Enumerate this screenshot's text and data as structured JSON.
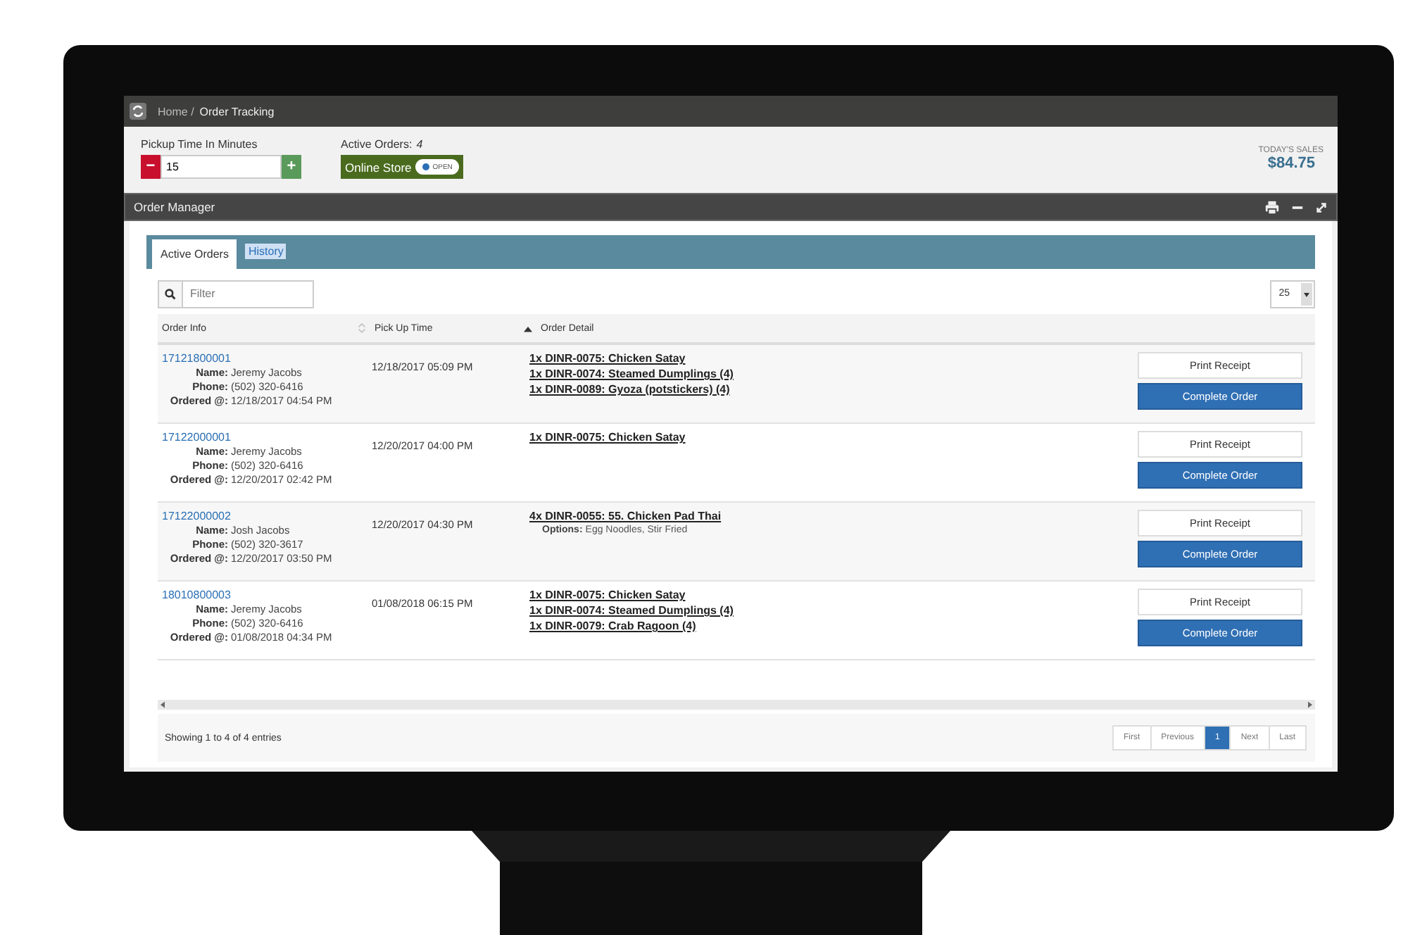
{
  "breadcrumb": [
    "Home /",
    "Order Tracking"
  ],
  "pickup": {
    "label": "Pickup Time In Minutes",
    "value": "15",
    "minus": "−",
    "plus": "+"
  },
  "active_orders": {
    "label": "Active Orders:",
    "count": "4"
  },
  "online_store": {
    "label": "Online Store",
    "on": true,
    "state_text": "OPEN"
  },
  "sales": {
    "label": "TODAY'S SALES",
    "amount": "$84.75"
  },
  "panel": {
    "title": "Order Manager"
  },
  "tabs": [
    {
      "label": "Active Orders",
      "selected": true
    },
    {
      "label": "History",
      "selected": false
    }
  ],
  "filter": {
    "placeholder": "Filter"
  },
  "page_size": "25",
  "columns": [
    {
      "label": "Order Info",
      "kind": "plain"
    },
    {
      "label": "Pick Up Time",
      "kind": "sortable"
    },
    {
      "label": "Order Detail",
      "kind": "ascending"
    }
  ],
  "rows": [
    {
      "order": "17121800001",
      "fields": [
        {
          "label": "Name:",
          "value": "Jeremy Jacobs"
        },
        {
          "label": "Phone:",
          "value": "(502) 320-6416"
        },
        {
          "label": "Ordered @:",
          "value": "12/18/2017 04:54 PM"
        }
      ],
      "pickup": "12/18/2017 05:09 PM",
      "items": [
        {
          "text": "1x DINR-0075: Chicken Satay"
        },
        {
          "text": "1x DINR-0074: Steamed Dumplings (4)"
        },
        {
          "text": "1x DINR-0089: Gyoza (potstickers) (4)"
        }
      ],
      "buttons": [
        "Print Receipt",
        "Complete Order"
      ]
    },
    {
      "order": "17122000001",
      "fields": [
        {
          "label": "Name:",
          "value": "Jeremy Jacobs"
        },
        {
          "label": "Phone:",
          "value": "(502) 320-6416"
        },
        {
          "label": "Ordered @:",
          "value": "12/20/2017 02:42 PM"
        }
      ],
      "pickup": "12/20/2017 04:00 PM",
      "items": [
        {
          "text": "1x DINR-0075: Chicken Satay"
        }
      ],
      "buttons": [
        "Print Receipt",
        "Complete Order"
      ]
    },
    {
      "order": "17122000002",
      "fields": [
        {
          "label": "Name:",
          "value": "Josh Jacobs"
        },
        {
          "label": "Phone:",
          "value": "(502) 320-3617"
        },
        {
          "label": "Ordered @:",
          "value": "12/20/2017 03:50 PM"
        }
      ],
      "pickup": "12/20/2017 04:30 PM",
      "items": [
        {
          "text": "4x DINR-0055: 55. Chicken Pad Thai",
          "options_label": "Options:",
          "options": "Egg Noodles, Stir Fried"
        }
      ],
      "buttons": [
        "Print Receipt",
        "Complete Order"
      ]
    },
    {
      "order": "18010800003",
      "fields": [
        {
          "label": "Name:",
          "value": "Jeremy Jacobs"
        },
        {
          "label": "Phone:",
          "value": "(502) 320-6416"
        },
        {
          "label": "Ordered @:",
          "value": "01/08/2018 04:34 PM"
        }
      ],
      "pickup": "01/08/2018 06:15 PM",
      "items": [
        {
          "text": "1x DINR-0075: Chicken Satay"
        },
        {
          "text": "1x DINR-0074: Steamed Dumplings (4)"
        },
        {
          "text": "1x DINR-0079: Crab Ragoon (4)"
        }
      ],
      "buttons": [
        "Print Receipt",
        "Complete Order"
      ]
    }
  ],
  "footer": "Showing 1 to 4 of 4 entries",
  "pagination": [
    {
      "label": "First",
      "selected": false
    },
    {
      "label": "Previous",
      "selected": false
    },
    {
      "label": "1",
      "selected": true
    },
    {
      "label": "Next",
      "selected": false
    },
    {
      "label": "Last",
      "selected": false
    }
  ]
}
